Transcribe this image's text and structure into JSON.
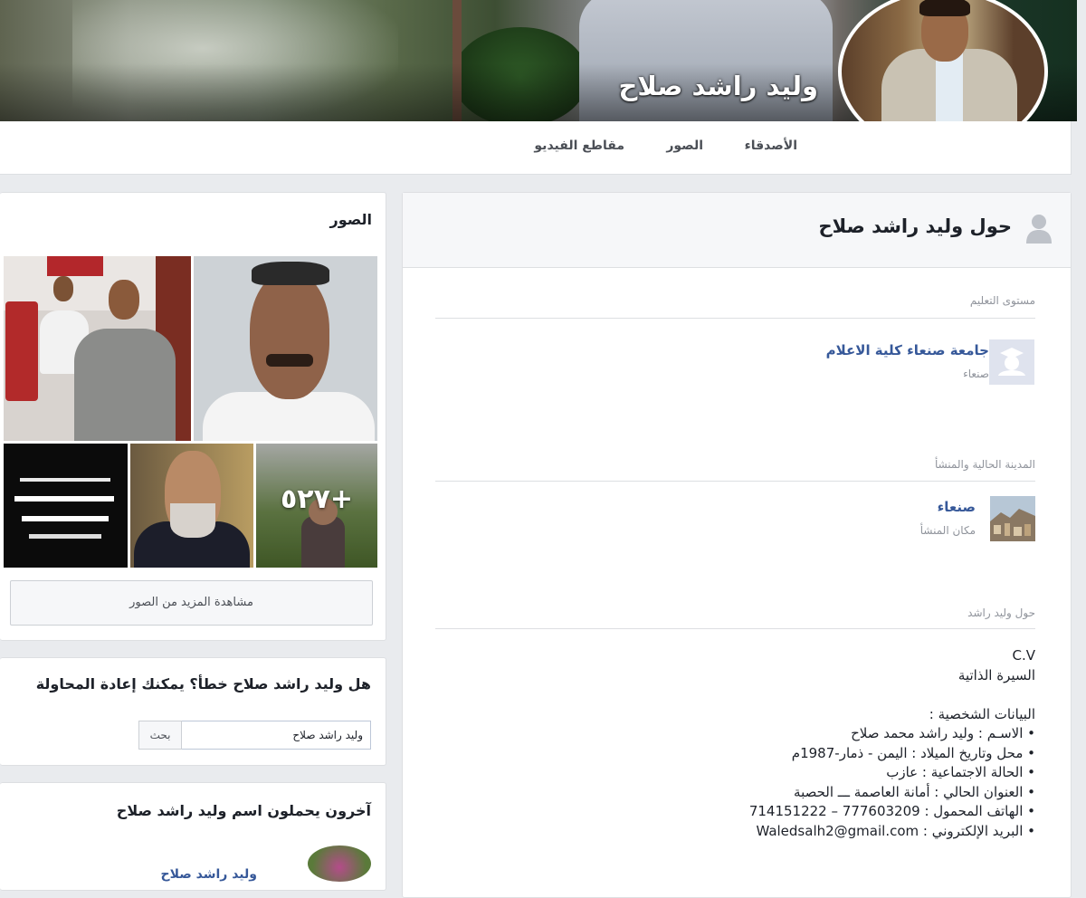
{
  "profile": {
    "name": "وليد راشد صلاح"
  },
  "nav": {
    "friends": "الأصدقاء",
    "photos": "الصور",
    "videos": "مقاطع الفيديو"
  },
  "about": {
    "title": "حول وليد راشد صلاح",
    "education": {
      "section_title": "مستوى التعليم",
      "school": "جامعة صنعاء كلية الاعلام",
      "location": "صنعاء"
    },
    "places": {
      "section_title": "المدينة الحالية والمنشأ",
      "city": "صنعاء",
      "type": "مكان المنشأ"
    },
    "bio": {
      "section_title": "حول وليد راشد",
      "lines": [
        "C.V",
        "السيرة الذاتية",
        "",
        "البيانات الشخصية :",
        "• الاسـم : وليد راشد محمد صلاح",
        "• محل وتاريخ الميلاد : اليمن - ذمار-1987م",
        "• الحالة الاجتماعية : عازب",
        "• العنوان الحالي : أمانة العاصمة ـــ الحصبة",
        "• الهاتف المحمول : 777603209 – 714151222",
        "• البريد الإلكتروني : Waledsalh2@gmail.com"
      ]
    }
  },
  "photos": {
    "title": "الصور",
    "more_count": "+٥٢٧",
    "more_button": "مشاهدة المزيد من الصور"
  },
  "retry": {
    "title": "هل وليد راشد صلاح خطأ؟ يمكنك إعادة المحاولة",
    "search_value": "وليد راشد صلاح",
    "search_button": "بحث"
  },
  "others": {
    "title": "آخرون يحملون اسم وليد راشد صلاح",
    "first_name": "وليد راشد صلاح"
  }
}
